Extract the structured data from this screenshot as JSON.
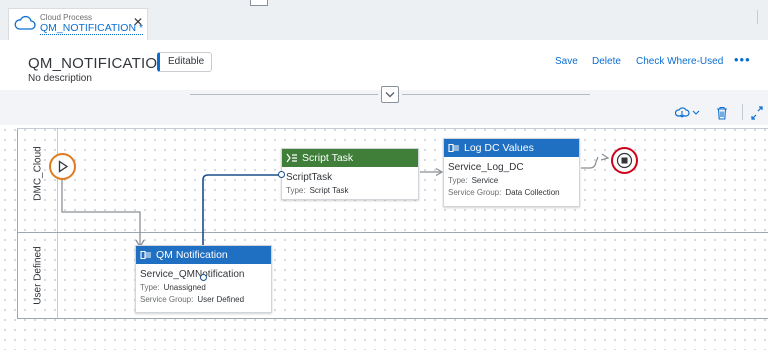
{
  "tab": {
    "subtitle": "Cloud Process",
    "title": "QM_NOTIFICATION *",
    "close": "✕"
  },
  "header": {
    "title": "QM_NOTIFICATION",
    "badge": "Editable",
    "description": "No description",
    "actions": {
      "save": "Save",
      "delete": "Delete",
      "check": "Check Where-Used",
      "more": "•••"
    }
  },
  "lanes": [
    {
      "label": "DMC_Cloud"
    },
    {
      "label": "User Defined"
    }
  ],
  "tasks": {
    "script": {
      "header": "Script Task",
      "name": "ScriptTask",
      "type_label": "Type:",
      "type": "Script Task"
    },
    "logdc": {
      "header": "Log DC Values",
      "name": "Service_Log_DC",
      "type_label": "Type:",
      "type": "Service",
      "group_label": "Service Group:",
      "group": "Data Collection"
    },
    "qm": {
      "header": "QM Notification",
      "name": "Service_QMNotification",
      "type_label": "Type:",
      "type": "Unassigned",
      "group_label": "Service Group:",
      "group": "User Defined"
    }
  },
  "colors": {
    "accent": "#0a6ed1",
    "service_header": "#1f6fc2",
    "script_header": "#3f7f3a",
    "start_event": "#e07b1d",
    "end_event": "#d0021b"
  }
}
